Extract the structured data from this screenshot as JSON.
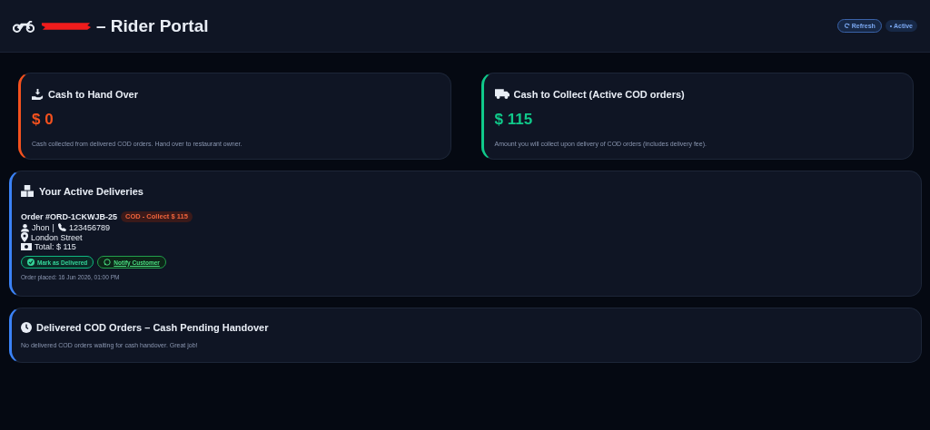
{
  "header": {
    "title": "– Rider Portal",
    "refresh_button": "Refresh",
    "status_badge": "• Active"
  },
  "summary_cards": [
    {
      "title": "Cash to Hand Over",
      "amount": "$ 0",
      "description": "Cash collected from delivered COD orders. Hand over to restaurant owner.",
      "color": "#f4511e"
    },
    {
      "title": "Cash to Collect (Active COD orders)",
      "amount": "$ 115",
      "description": "Amount you will collect upon delivery of COD orders (includes delivery fee).",
      "color": "#10c98a"
    }
  ],
  "active_deliveries": {
    "title": "Your Active Deliveries",
    "orders": [
      {
        "order_id": "Order #ORD-1CKWJB-25",
        "badge": "COD - Collect $ 115",
        "customer": "Jhon",
        "separator": "|",
        "phone": "123456789",
        "address": "London Street",
        "total": "Total: $ 115",
        "buttons": [
          "Mark as Delivered",
          "Notify Customer"
        ],
        "placed": "Order placed: 16 Jun 2026, 01:00 PM"
      }
    ]
  },
  "delivered_section": {
    "title": "Delivered COD Orders – Cash Pending Handover",
    "message": "No delivered COD orders waiting for cash handover. Great job!"
  }
}
